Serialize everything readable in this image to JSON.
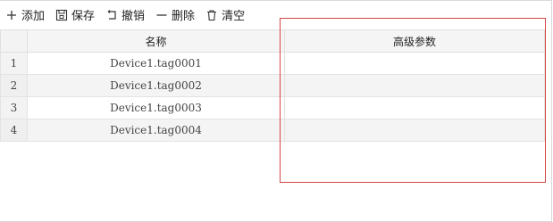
{
  "toolbar": {
    "buttons": [
      {
        "label": "添加",
        "icon": "plus-icon"
      },
      {
        "label": "保存",
        "icon": "save-icon"
      },
      {
        "label": "撤销",
        "icon": "undo-icon"
      },
      {
        "label": "删除",
        "icon": "minus-icon"
      },
      {
        "label": "清空",
        "icon": "trash-icon"
      }
    ]
  },
  "grid": {
    "columns": [
      "",
      "名称",
      "高级参数"
    ],
    "rows": [
      {
        "index": "1",
        "name": "Device1.tag0001",
        "advanced": ""
      },
      {
        "index": "2",
        "name": "Device1.tag0002",
        "advanced": ""
      },
      {
        "index": "3",
        "name": "Device1.tag0003",
        "advanced": ""
      },
      {
        "index": "4",
        "name": "Device1.tag0004",
        "advanced": ""
      }
    ]
  },
  "colors": {
    "highlight_border": "#d64545",
    "header_bg": "#f5f5f5",
    "alt_row_bg": "#f4f4f4"
  }
}
